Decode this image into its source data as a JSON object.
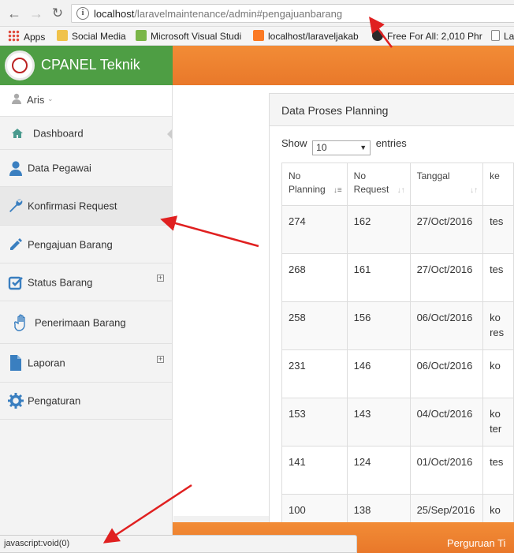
{
  "browser": {
    "url_host": "localhost",
    "url_path": "/laravelmaintenance/admin#pengajuanbarang",
    "bookmarks": [
      {
        "label": "Apps",
        "icon": "apps-grid-icon"
      },
      {
        "label": "Social Media",
        "icon": "folder-icon"
      },
      {
        "label": "Microsoft Visual Studi",
        "icon": "visual-studio-icon"
      },
      {
        "label": "localhost/laraveljakab",
        "icon": "xampp-icon"
      },
      {
        "label": "Free For All: 2,010 Phr",
        "icon": "site-logo-icon"
      },
      {
        "label": "La",
        "icon": "page-icon"
      }
    ],
    "status_text": "javascript:void(0)"
  },
  "app": {
    "title": "CPANEL Teknik",
    "colors": {
      "green": "#4e9e44",
      "orange": "#ef8431",
      "annotation_red": "#e02020"
    }
  },
  "sidebar": {
    "user": "Aris",
    "items": [
      {
        "label": "Dashboard",
        "icon": "home-icon"
      },
      {
        "label": "Data Pegawai",
        "icon": "user-icon"
      },
      {
        "label": "Konfirmasi Request",
        "icon": "wrench-icon"
      },
      {
        "label": "Pengajuan Barang",
        "icon": "pencil-icon"
      },
      {
        "label": "Status Barang",
        "icon": "checkbox-icon",
        "expandable": true
      },
      {
        "label": "Penerimaan Barang",
        "icon": "hand-icon"
      },
      {
        "label": "Laporan",
        "icon": "file-icon",
        "expandable": true
      },
      {
        "label": "Pengaturan",
        "icon": "gear-icon"
      }
    ]
  },
  "panel": {
    "title": "Data Proses Planning",
    "show_label": "Show",
    "show_value": "10",
    "entries_label": "entries"
  },
  "table": {
    "columns": [
      {
        "line1": "No",
        "line2": "Planning"
      },
      {
        "line1": "No",
        "line2": "Request"
      },
      {
        "line1": "Tanggal",
        "line2": ""
      },
      {
        "line1": "ke",
        "line2": ""
      }
    ],
    "rows": [
      [
        "274",
        "162",
        "27/Oct/2016",
        "tes",
        ""
      ],
      [
        "268",
        "161",
        "27/Oct/2016",
        "tes",
        ""
      ],
      [
        "258",
        "156",
        "06/Oct/2016",
        "ko",
        "res"
      ],
      [
        "231",
        "146",
        "06/Oct/2016",
        "ko",
        ""
      ],
      [
        "153",
        "143",
        "04/Oct/2016",
        "ko",
        "ter"
      ],
      [
        "141",
        "124",
        "01/Oct/2016",
        "tes",
        ""
      ],
      [
        "100",
        "138",
        "25/Sep/2016",
        "ko",
        ""
      ]
    ]
  },
  "footer": {
    "text": "Perguruan Ti"
  }
}
